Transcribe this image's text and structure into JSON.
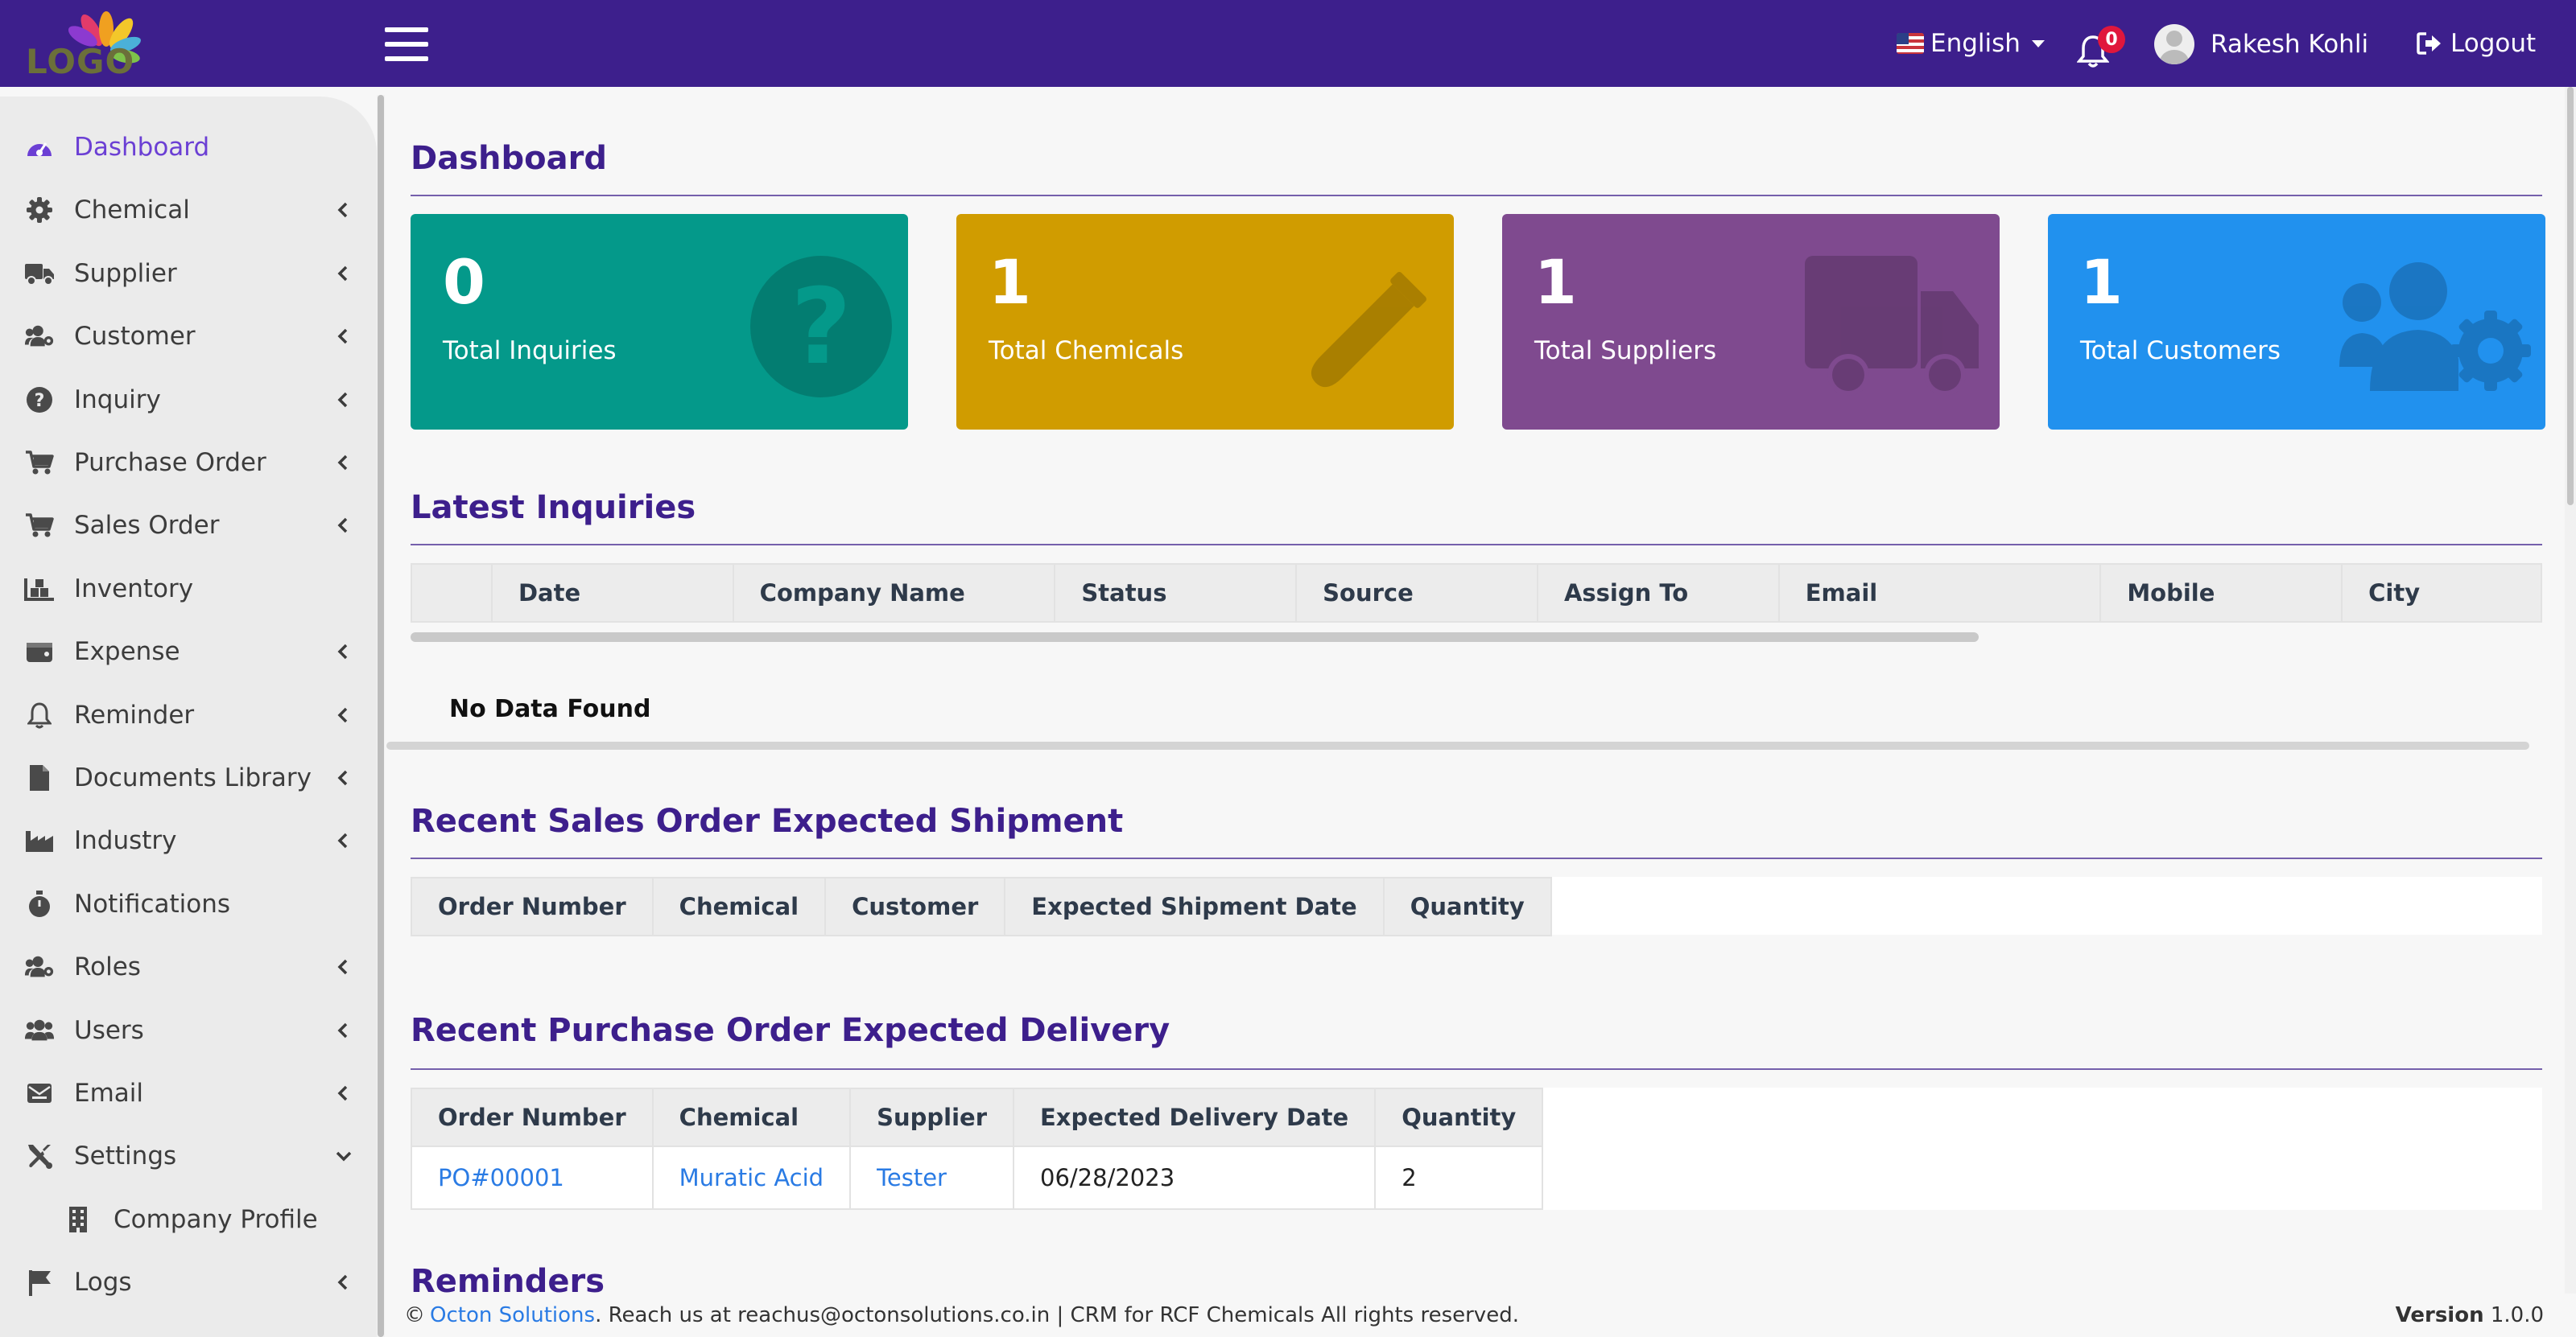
{
  "header": {
    "logo_text": "LOGO",
    "language": "English",
    "notification_count": "0",
    "user_name": "Rakesh Kohli",
    "logout_label": "Logout"
  },
  "sidebar": {
    "items": [
      {
        "label": "Dashboard",
        "icon": "dashboard-icon",
        "active": true
      },
      {
        "label": "Chemical",
        "icon": "gear-icon",
        "expandable": true
      },
      {
        "label": "Supplier",
        "icon": "truck-icon",
        "expandable": true
      },
      {
        "label": "Customer",
        "icon": "users-cog-icon",
        "expandable": true
      },
      {
        "label": "Inquiry",
        "icon": "question-icon",
        "expandable": true
      },
      {
        "label": "Purchase Order",
        "icon": "cart-icon",
        "expandable": true
      },
      {
        "label": "Sales Order",
        "icon": "cart-icon",
        "expandable": true
      },
      {
        "label": "Inventory",
        "icon": "warehouse-icon",
        "expandable": false
      },
      {
        "label": "Expense",
        "icon": "wallet-icon",
        "expandable": true
      },
      {
        "label": "Reminder",
        "icon": "bell-icon",
        "expandable": true
      },
      {
        "label": "Documents Library",
        "icon": "document-icon",
        "expandable": true
      },
      {
        "label": "Industry",
        "icon": "industry-icon",
        "expandable": true
      },
      {
        "label": "Notifications",
        "icon": "stopwatch-icon",
        "expandable": false
      },
      {
        "label": "Roles",
        "icon": "users-cog-icon",
        "expandable": true
      },
      {
        "label": "Users",
        "icon": "users-icon",
        "expandable": true
      },
      {
        "label": "Email",
        "icon": "mail-icon",
        "expandable": true
      },
      {
        "label": "Settings",
        "icon": "tools-icon",
        "expandable": true,
        "expanded": true
      },
      {
        "label": "Company Profile",
        "icon": "building-icon",
        "sub": true
      },
      {
        "label": "Logs",
        "icon": "flag-icon",
        "expandable": true
      }
    ]
  },
  "dashboard": {
    "title": "Dashboard",
    "cards": [
      {
        "count": "0",
        "label": "Total Inquiries",
        "color": "#04998a",
        "icon": "question-icon"
      },
      {
        "count": "1",
        "label": "Total Chemicals",
        "color": "#d09c00",
        "icon": "test-tube-icon"
      },
      {
        "count": "1",
        "label": "Total Suppliers",
        "color": "#7f4a8f",
        "icon": "truck-icon"
      },
      {
        "count": "1",
        "label": "Total Customers",
        "color": "#2191ee",
        "icon": "users-cog-icon"
      }
    ]
  },
  "latest_inquiries": {
    "title": "Latest Inquiries",
    "columns": [
      "",
      "Date",
      "Company Name",
      "Status",
      "Source",
      "Assign To",
      "Email",
      "Mobile",
      "City"
    ],
    "empty_text": "No Data Found"
  },
  "sales_shipment": {
    "title": "Recent Sales Order Expected Shipment",
    "columns": [
      "Order Number",
      "Chemical",
      "Customer",
      "Expected Shipment Date",
      "Quantity"
    ]
  },
  "purchase_delivery": {
    "title": "Recent Purchase Order Expected Delivery",
    "columns": [
      "Order Number",
      "Chemical",
      "Supplier",
      "Expected Delivery Date",
      "Quantity"
    ],
    "rows": [
      {
        "order": "PO#00001",
        "chemical": "Muratic Acid",
        "supplier": "Tester",
        "date": "06/28/2023",
        "quantity": "2"
      }
    ]
  },
  "reminders": {
    "title": "Reminders"
  },
  "footer": {
    "copyright": "©",
    "company": "Octon Solutions",
    "text": ". Reach us at reachus@octonsolutions.co.in | CRM for RCF Chemicals All rights reserved.",
    "version_label": "Version",
    "version": "1.0.0"
  },
  "colors": {
    "header_bg": "#3d1f8c",
    "accent": "#6b3fd4",
    "link": "#2a7be4"
  }
}
